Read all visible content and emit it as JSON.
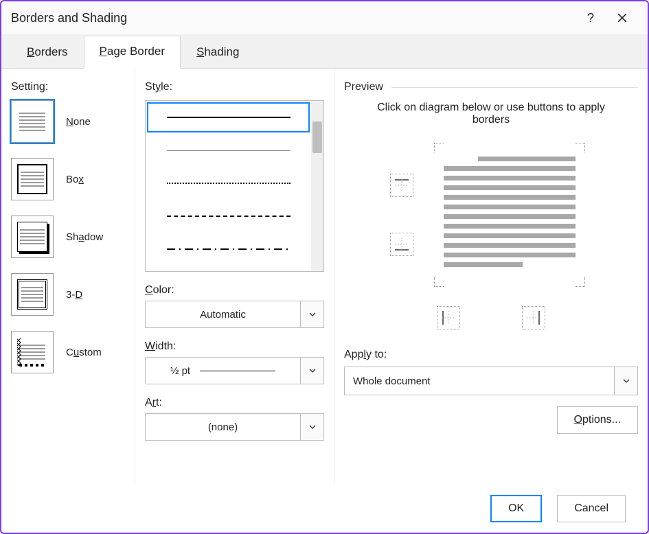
{
  "title": "Borders and Shading",
  "tabs": [
    {
      "label": "Borders"
    },
    {
      "label": "Page Border"
    },
    {
      "label": "Shading"
    }
  ],
  "setting": {
    "label": "Setting:",
    "options": [
      {
        "label": "None"
      },
      {
        "label": "Box"
      },
      {
        "label": "Shadow"
      },
      {
        "label": "3-D"
      },
      {
        "label": "Custom"
      }
    ]
  },
  "style": {
    "label": "Style:",
    "color_label": "Color:",
    "color_value": "Automatic",
    "width_label": "Width:",
    "width_value": "½ pt",
    "art_label": "Art:",
    "art_value": "(none)"
  },
  "preview": {
    "label": "Preview",
    "hint": "Click on diagram below or use buttons to apply borders",
    "apply_label": "Apply to:",
    "apply_value": "Whole document",
    "options_label": "Options..."
  },
  "buttons": {
    "ok": "OK",
    "cancel": "Cancel"
  }
}
